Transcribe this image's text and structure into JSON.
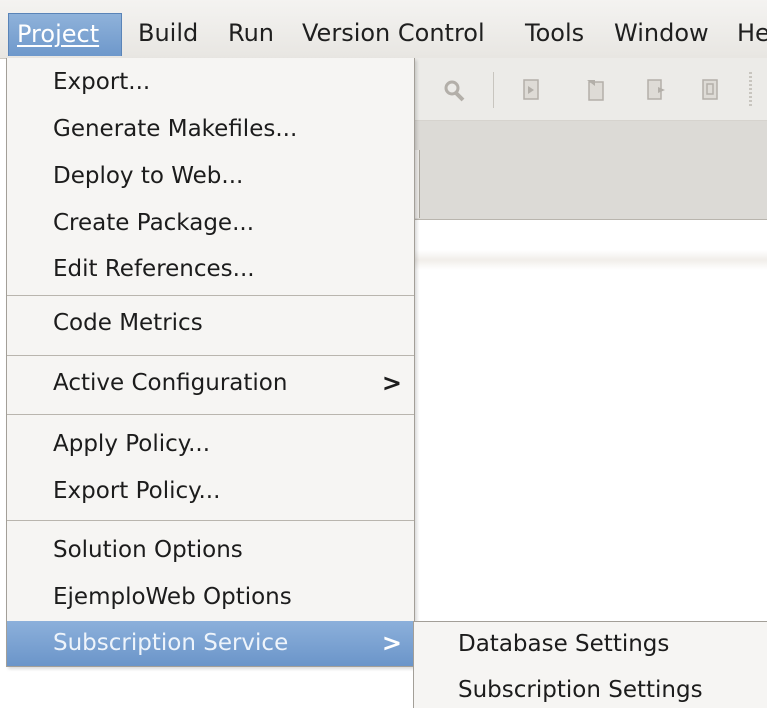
{
  "menubar": {
    "items": [
      {
        "label": "Project",
        "active": true
      },
      {
        "label": "Build"
      },
      {
        "label": "Run"
      },
      {
        "label": "Version Control"
      },
      {
        "label": "Tools"
      },
      {
        "label": "Window"
      },
      {
        "label": "He"
      }
    ]
  },
  "project_menu": {
    "export": "Export...",
    "generate_makefiles": "Generate Makefiles...",
    "deploy_to_web": "Deploy to Web...",
    "create_package": "Create Package...",
    "edit_references": "Edit References...",
    "code_metrics": "Code Metrics",
    "active_configuration": "Active Configuration",
    "apply_policy": "Apply Policy...",
    "export_policy": "Export Policy...",
    "solution_options": "Solution Options",
    "project_options": "EjemploWeb Options",
    "subscription_service": "Subscription Service",
    "submenu_arrow": ">"
  },
  "subscription_submenu": {
    "database_settings": "Database Settings",
    "subscription_settings": "Subscription Settings"
  },
  "colors": {
    "highlight": "#7aa1d1",
    "menu_bg": "#f6f5f3",
    "separator": "#b9b5ae"
  }
}
